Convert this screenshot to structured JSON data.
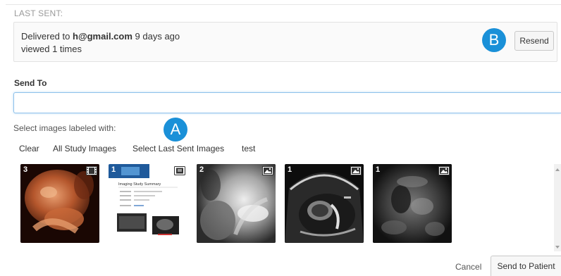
{
  "last_sent": {
    "title": "LAST SENT:",
    "delivered_prefix": "Delivered to",
    "email": "h@gmail.com",
    "delivered_suffix": " 9 days ago",
    "viewed": "viewed 1 times",
    "resend_label": "Resend"
  },
  "markers": {
    "a": "A",
    "b": "B"
  },
  "send_to": {
    "label": "Send To",
    "value": "",
    "placeholder": ""
  },
  "select_label": "Select images labeled with:",
  "filters": [
    "Clear",
    "All Study Images",
    "Select Last Sent Images",
    "test"
  ],
  "thumbnails": [
    {
      "count": "3",
      "icon": "film-icon",
      "subject": "3d-ultrasound-baby-face"
    },
    {
      "count": "1",
      "icon": "book-icon",
      "subject": "imaging-study-summary-document",
      "doc_title": "Imaging Study Summary"
    },
    {
      "count": "2",
      "icon": "image-icon",
      "subject": "grayscale-ultrasound"
    },
    {
      "count": "1",
      "icon": "image-icon",
      "subject": "fetal-ultrasound-profile"
    },
    {
      "count": "1",
      "icon": "image-icon",
      "subject": "speckled-ultrasound"
    }
  ],
  "footer": {
    "cancel_label": "Cancel",
    "send_label": "Send to Patient"
  },
  "colors": {
    "accent": "#1a90d8",
    "input_focus": "#8ec1ea",
    "panel_bg": "#fafafa"
  }
}
